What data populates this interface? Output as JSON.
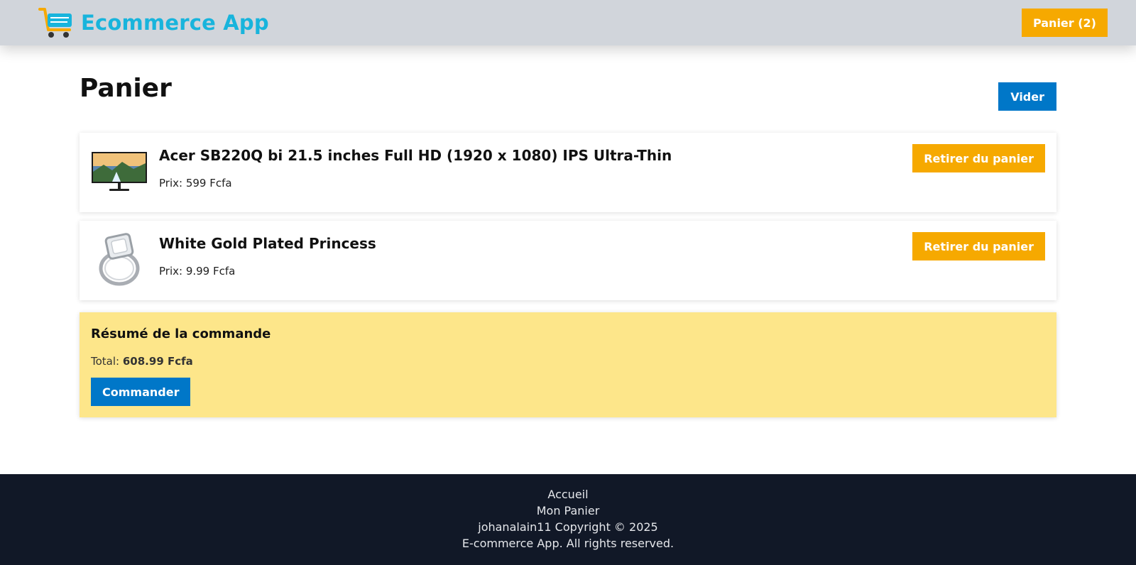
{
  "header": {
    "brand_title": "Ecommerce App",
    "brand_icon": "shopping-cart-icon",
    "cart_button_label": "Panier (2)"
  },
  "main": {
    "page_title": "Panier",
    "clear_button_label": "Vider",
    "items": [
      {
        "title": "Acer SB220Q bi 21.5 inches Full HD (1920 x 1080) IPS Ultra-Thin",
        "price": "Prix: 599 Fcfa",
        "thumbnail_icon": "monitor-image",
        "remove_label": "Retirer du panier"
      },
      {
        "title": "White Gold Plated Princess",
        "price": "Prix: 9.99 Fcfa",
        "thumbnail_icon": "ring-image",
        "remove_label": "Retirer du panier"
      }
    ],
    "summary": {
      "title": "Résumé de la commande",
      "total_label": "Total:",
      "total_value": "608.99 Fcfa",
      "order_button_label": "Commander"
    }
  },
  "footer": {
    "home_link": "Accueil",
    "cart_link": "Mon Panier",
    "copyright": "johanalain11 Copyright © 2025",
    "rights": "E-commerce App. All rights reserved."
  },
  "colors": {
    "header_bg": "#d1d5db",
    "brand": "#18b4dc",
    "accent_orange": "#f6a900",
    "primary_blue": "#0077c8",
    "summary_bg": "#fde68a",
    "footer_bg": "#111827"
  }
}
